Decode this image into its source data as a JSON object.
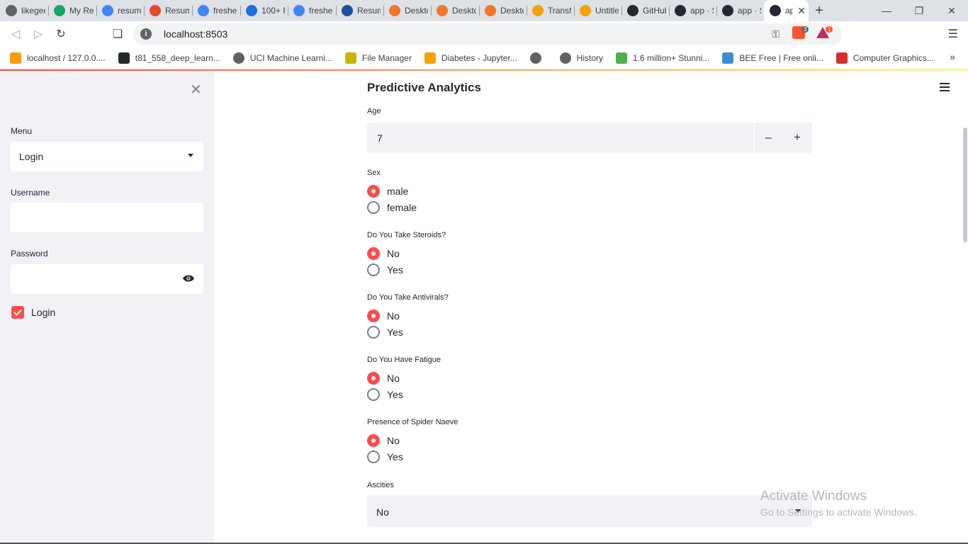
{
  "browser": {
    "tabs": [
      {
        "title": "likegee",
        "icon": "globe-icon",
        "color": "#5f6368"
      },
      {
        "title": "My Re",
        "icon": "cv-icon",
        "color": "#1aa36a"
      },
      {
        "title": "resum",
        "icon": "google-icon",
        "color": "#4285f4"
      },
      {
        "title": "Resum",
        "icon": "pdf-icon",
        "color": "#e24a2b"
      },
      {
        "title": "freshe",
        "icon": "google-icon",
        "color": "#4285f4"
      },
      {
        "title": "100+ F",
        "icon": "r-icon",
        "color": "#1f6fd6"
      },
      {
        "title": "freshe",
        "icon": "google-icon",
        "color": "#4285f4"
      },
      {
        "title": "Resum",
        "icon": "crescent-icon",
        "color": "#1f4f9e"
      },
      {
        "title": "Deskto",
        "icon": "jupyter-icon",
        "color": "#f37726"
      },
      {
        "title": "Deskto",
        "icon": "jupyter-icon",
        "color": "#f37726"
      },
      {
        "title": "Deskto",
        "icon": "jupyter-icon",
        "color": "#f37726"
      },
      {
        "title": "Transfe",
        "icon": "notebook-icon",
        "color": "#f2a20c"
      },
      {
        "title": "Untitle",
        "icon": "notebook-icon",
        "color": "#f2a20c"
      },
      {
        "title": "GitHub",
        "icon": "github-icon",
        "color": "#24292e"
      },
      {
        "title": "app · S",
        "icon": "streamlit-icon",
        "color": "#262730"
      },
      {
        "title": "app · S",
        "icon": "streamlit-icon",
        "color": "#262730"
      },
      {
        "title": "app",
        "icon": "streamlit-icon",
        "color": "#262730"
      }
    ],
    "new_tab": "+",
    "url": "localhost:8503",
    "brave_badge": "3",
    "rewards_badge": "1",
    "bookmarks": [
      {
        "label": "localhost / 127.0.0....",
        "color": "#f89c0e"
      },
      {
        "label": "t81_558_deep_learn...",
        "color": "#24292e"
      },
      {
        "label": "UCI Machine Learni...",
        "color": "#5f6368"
      },
      {
        "label": "File Manager",
        "color": "#c8b400"
      },
      {
        "label": "Diabetes - Jupyter...",
        "color": "#f2a20c"
      },
      {
        "label": "",
        "color": "#5f6368"
      },
      {
        "label": "History",
        "color": "#5f6368"
      },
      {
        "label": "1.6 million+ Stunni...",
        "color": "#4caf50"
      },
      {
        "label": "BEE Free | Free onli...",
        "color": "#3b8ed0"
      },
      {
        "label": "Computer Graphics...",
        "color": "#d32f2f"
      }
    ],
    "bookmarks_more": "»"
  },
  "sidebar": {
    "menu_label": "Menu",
    "menu_value": "Login",
    "username_label": "Username",
    "username_value": "",
    "password_label": "Password",
    "password_value": "",
    "login_checkbox_label": "Login",
    "login_checked": true
  },
  "main": {
    "title": "Predictive Analytics",
    "age": {
      "label": "Age",
      "value": "7",
      "minus": "–",
      "plus": "+"
    },
    "radios": [
      {
        "label": "Sex",
        "options": [
          "male",
          "female"
        ],
        "selected": 0
      },
      {
        "label": "Do You Take Steroids?",
        "options": [
          "No",
          "Yes"
        ],
        "selected": 0
      },
      {
        "label": "Do You Take Antivirals?",
        "options": [
          "No",
          "Yes"
        ],
        "selected": 0
      },
      {
        "label": "Do You Have Fatigue",
        "options": [
          "No",
          "Yes"
        ],
        "selected": 0
      },
      {
        "label": "Presence of Spider Naeve",
        "options": [
          "No",
          "Yes"
        ],
        "selected": 0
      }
    ],
    "ascites": {
      "label": "Ascities",
      "value": "No"
    }
  },
  "watermark": {
    "line1": "Activate Windows",
    "line2": "Go to Settings to activate Windows."
  },
  "colors": {
    "accent": "#ff4b4b",
    "sidebar_bg": "#f0f2f6",
    "widget_bg": "#f0f2f6"
  }
}
